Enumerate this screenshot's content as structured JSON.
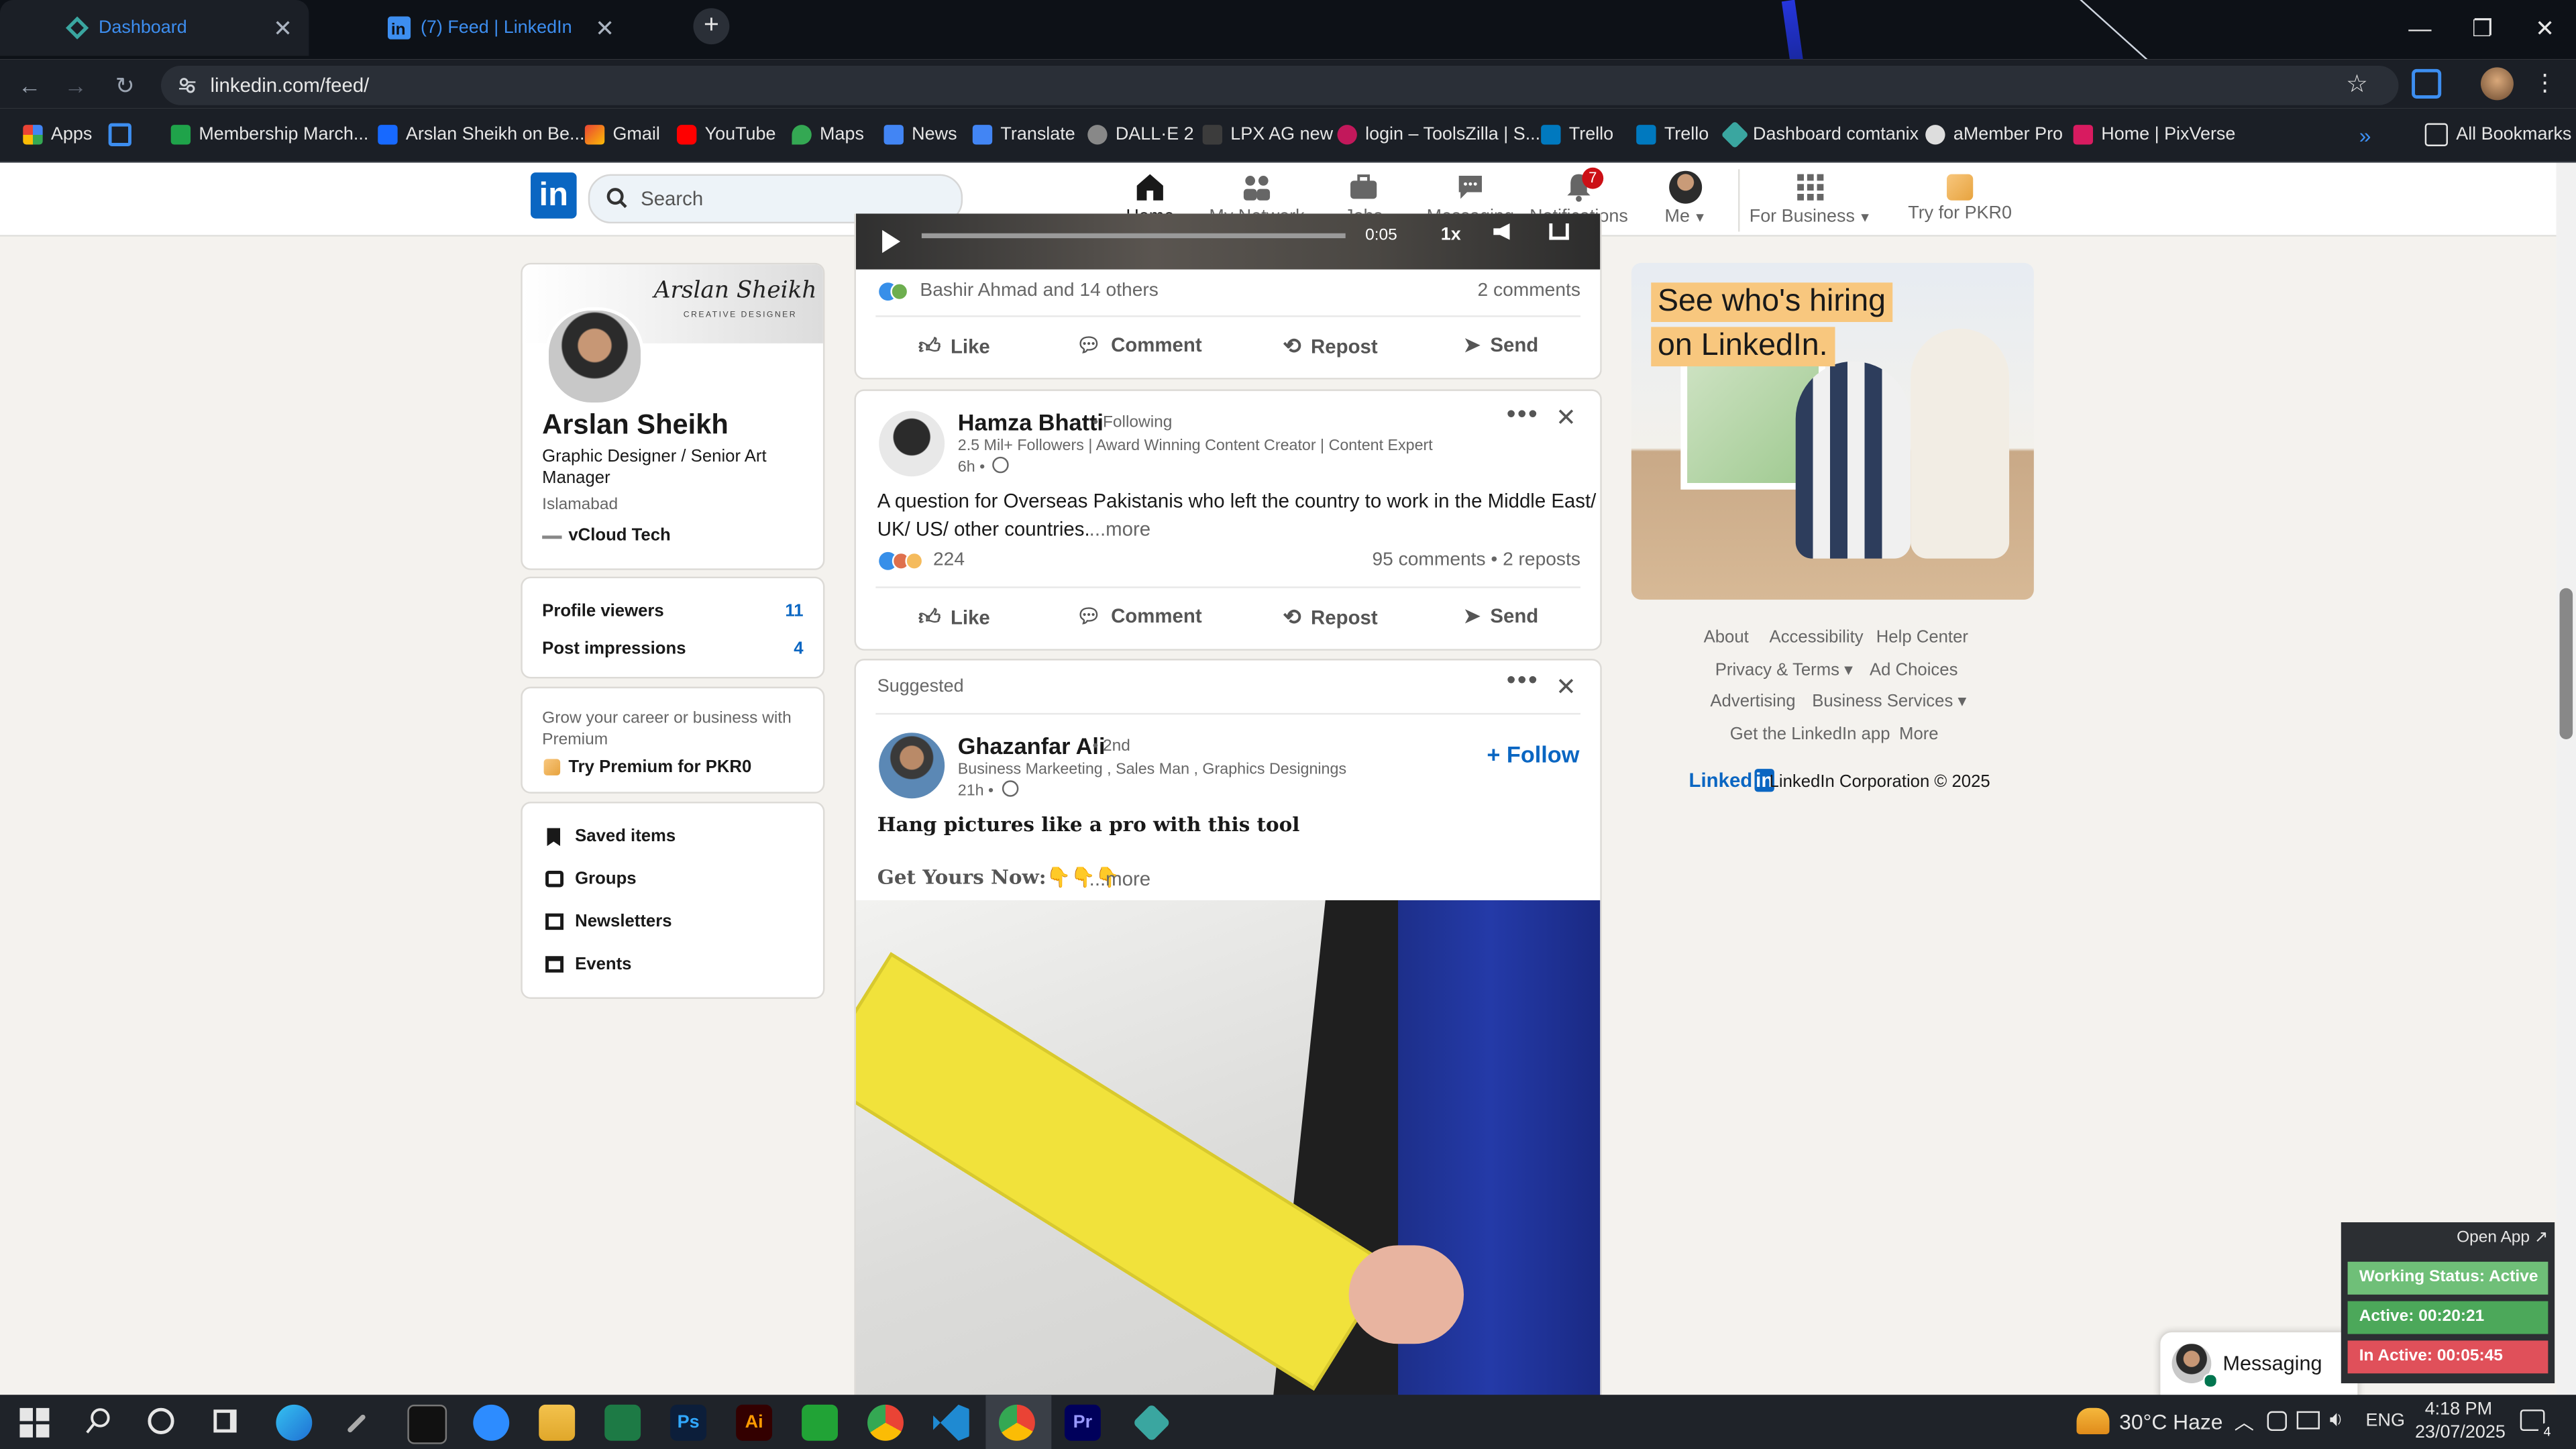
{
  "browser": {
    "tabs": [
      {
        "title": "Dashboard",
        "active": true
      },
      {
        "title": "(7) Feed | LinkedIn",
        "active": false
      }
    ],
    "new_tab": "+",
    "url": "linkedin.com/feed/",
    "bookmarks": [
      {
        "label": "Apps"
      },
      {
        "label": "Membership March..."
      },
      {
        "label": "Arslan Sheikh on Be..."
      },
      {
        "label": "Gmail"
      },
      {
        "label": "YouTube"
      },
      {
        "label": "Maps"
      },
      {
        "label": "News"
      },
      {
        "label": "Translate"
      },
      {
        "label": "DALL·E 2"
      },
      {
        "label": "LPX AG new"
      },
      {
        "label": "login – ToolsZilla | S..."
      },
      {
        "label": "Trello"
      },
      {
        "label": "Trello"
      },
      {
        "label": "Dashboard comtanix"
      },
      {
        "label": "aMember Pro"
      },
      {
        "label": "Home | PixVerse"
      }
    ],
    "all_bookmarks": "All Bookmarks"
  },
  "linkedin": {
    "search_placeholder": "Search",
    "nav": [
      {
        "label": "Home",
        "icon": "home-icon"
      },
      {
        "label": "My Network",
        "icon": "network-icon"
      },
      {
        "label": "Jobs",
        "icon": "briefcase-icon"
      },
      {
        "label": "Messaging",
        "icon": "chat-icon"
      },
      {
        "label": "Notifications",
        "icon": "bell-icon",
        "badge": "7"
      },
      {
        "label": "Me",
        "icon": "avatar"
      },
      {
        "label": "For Business",
        "icon": "grid-icon"
      },
      {
        "label": "Try for PKR0",
        "icon": "premium-icon"
      }
    ],
    "profile": {
      "banner_text": "Arslan Sheikh",
      "banner_sub": "CREATIVE DESIGNER",
      "name": "Arslan Sheikh",
      "headline": "Graphic Designer / Senior Art Manager",
      "location": "Islamabad",
      "company": "vCloud Tech"
    },
    "stats": [
      {
        "label": "Profile viewers",
        "value": "11"
      },
      {
        "label": "Post impressions",
        "value": "4"
      }
    ],
    "premium": {
      "text": "Grow your career or business with Premium",
      "cta": "Try Premium for PKR0"
    },
    "shortcuts": [
      "Saved items",
      "Groups",
      "Newsletters",
      "Events"
    ],
    "video_bar": {
      "time": "0:05",
      "speed": "1x"
    },
    "post1": {
      "reactions": "Bashir Ahmad and 14 others",
      "comments": "2 comments",
      "actions": [
        "Like",
        "Comment",
        "Repost",
        "Send"
      ]
    },
    "post2": {
      "author": "Hamza Bhatti",
      "following": "• Following",
      "subtitle": "2.5 Mil+ Followers | Award Winning Content Creator | Content Expert",
      "time": "6h •",
      "text_line1": "A question for Overseas Pakistanis who left the country to work in the Middle East/",
      "text_line2": "UK/ US/ other countries.",
      "more": "...more",
      "reaction_count": "224",
      "stats": "95 comments • 2 reposts",
      "actions": [
        "Like",
        "Comment",
        "Repost",
        "Send"
      ]
    },
    "post3": {
      "header": "Suggested",
      "author": "Ghazanfar Ali",
      "degree": "• 2nd",
      "subtitle": "Business Markeeting , Sales Man , Graphics Designings",
      "time": "21h •",
      "follow": "+ Follow",
      "text_line1": "Hang pictures like a pro with this tool",
      "text_line2": "Get Yours Now:👇👇👇",
      "more": "...more"
    },
    "ad": {
      "line1": "See who's hiring",
      "line2": "on LinkedIn."
    },
    "footer_links": [
      [
        "About",
        "Accessibility",
        "Help Center"
      ],
      [
        "Privacy & Terms ▾",
        "Ad Choices"
      ],
      [
        "Advertising",
        "Business Services ▾"
      ],
      [
        "Get the LinkedIn app",
        "More"
      ]
    ],
    "copyright": "LinkedIn Corporation © 2025",
    "copyright_logo": "Linked",
    "messaging": "Messaging"
  },
  "widget": {
    "open_app": "Open App ↗",
    "status": "Working Status: Active",
    "active": "Active: 00:20:21",
    "inactive": "In Active: 00:05:45"
  },
  "taskbar": {
    "weather": "30°C  Haze",
    "lang": "ENG",
    "time": "4:18 PM",
    "date": "23/07/2025",
    "notif_count": "4"
  },
  "colors": {
    "linkedin_blue": "#0a66c2",
    "tab_blue": "#3d8ef0",
    "widget_green": "#5cb85c",
    "widget_red": "#e0505a"
  }
}
